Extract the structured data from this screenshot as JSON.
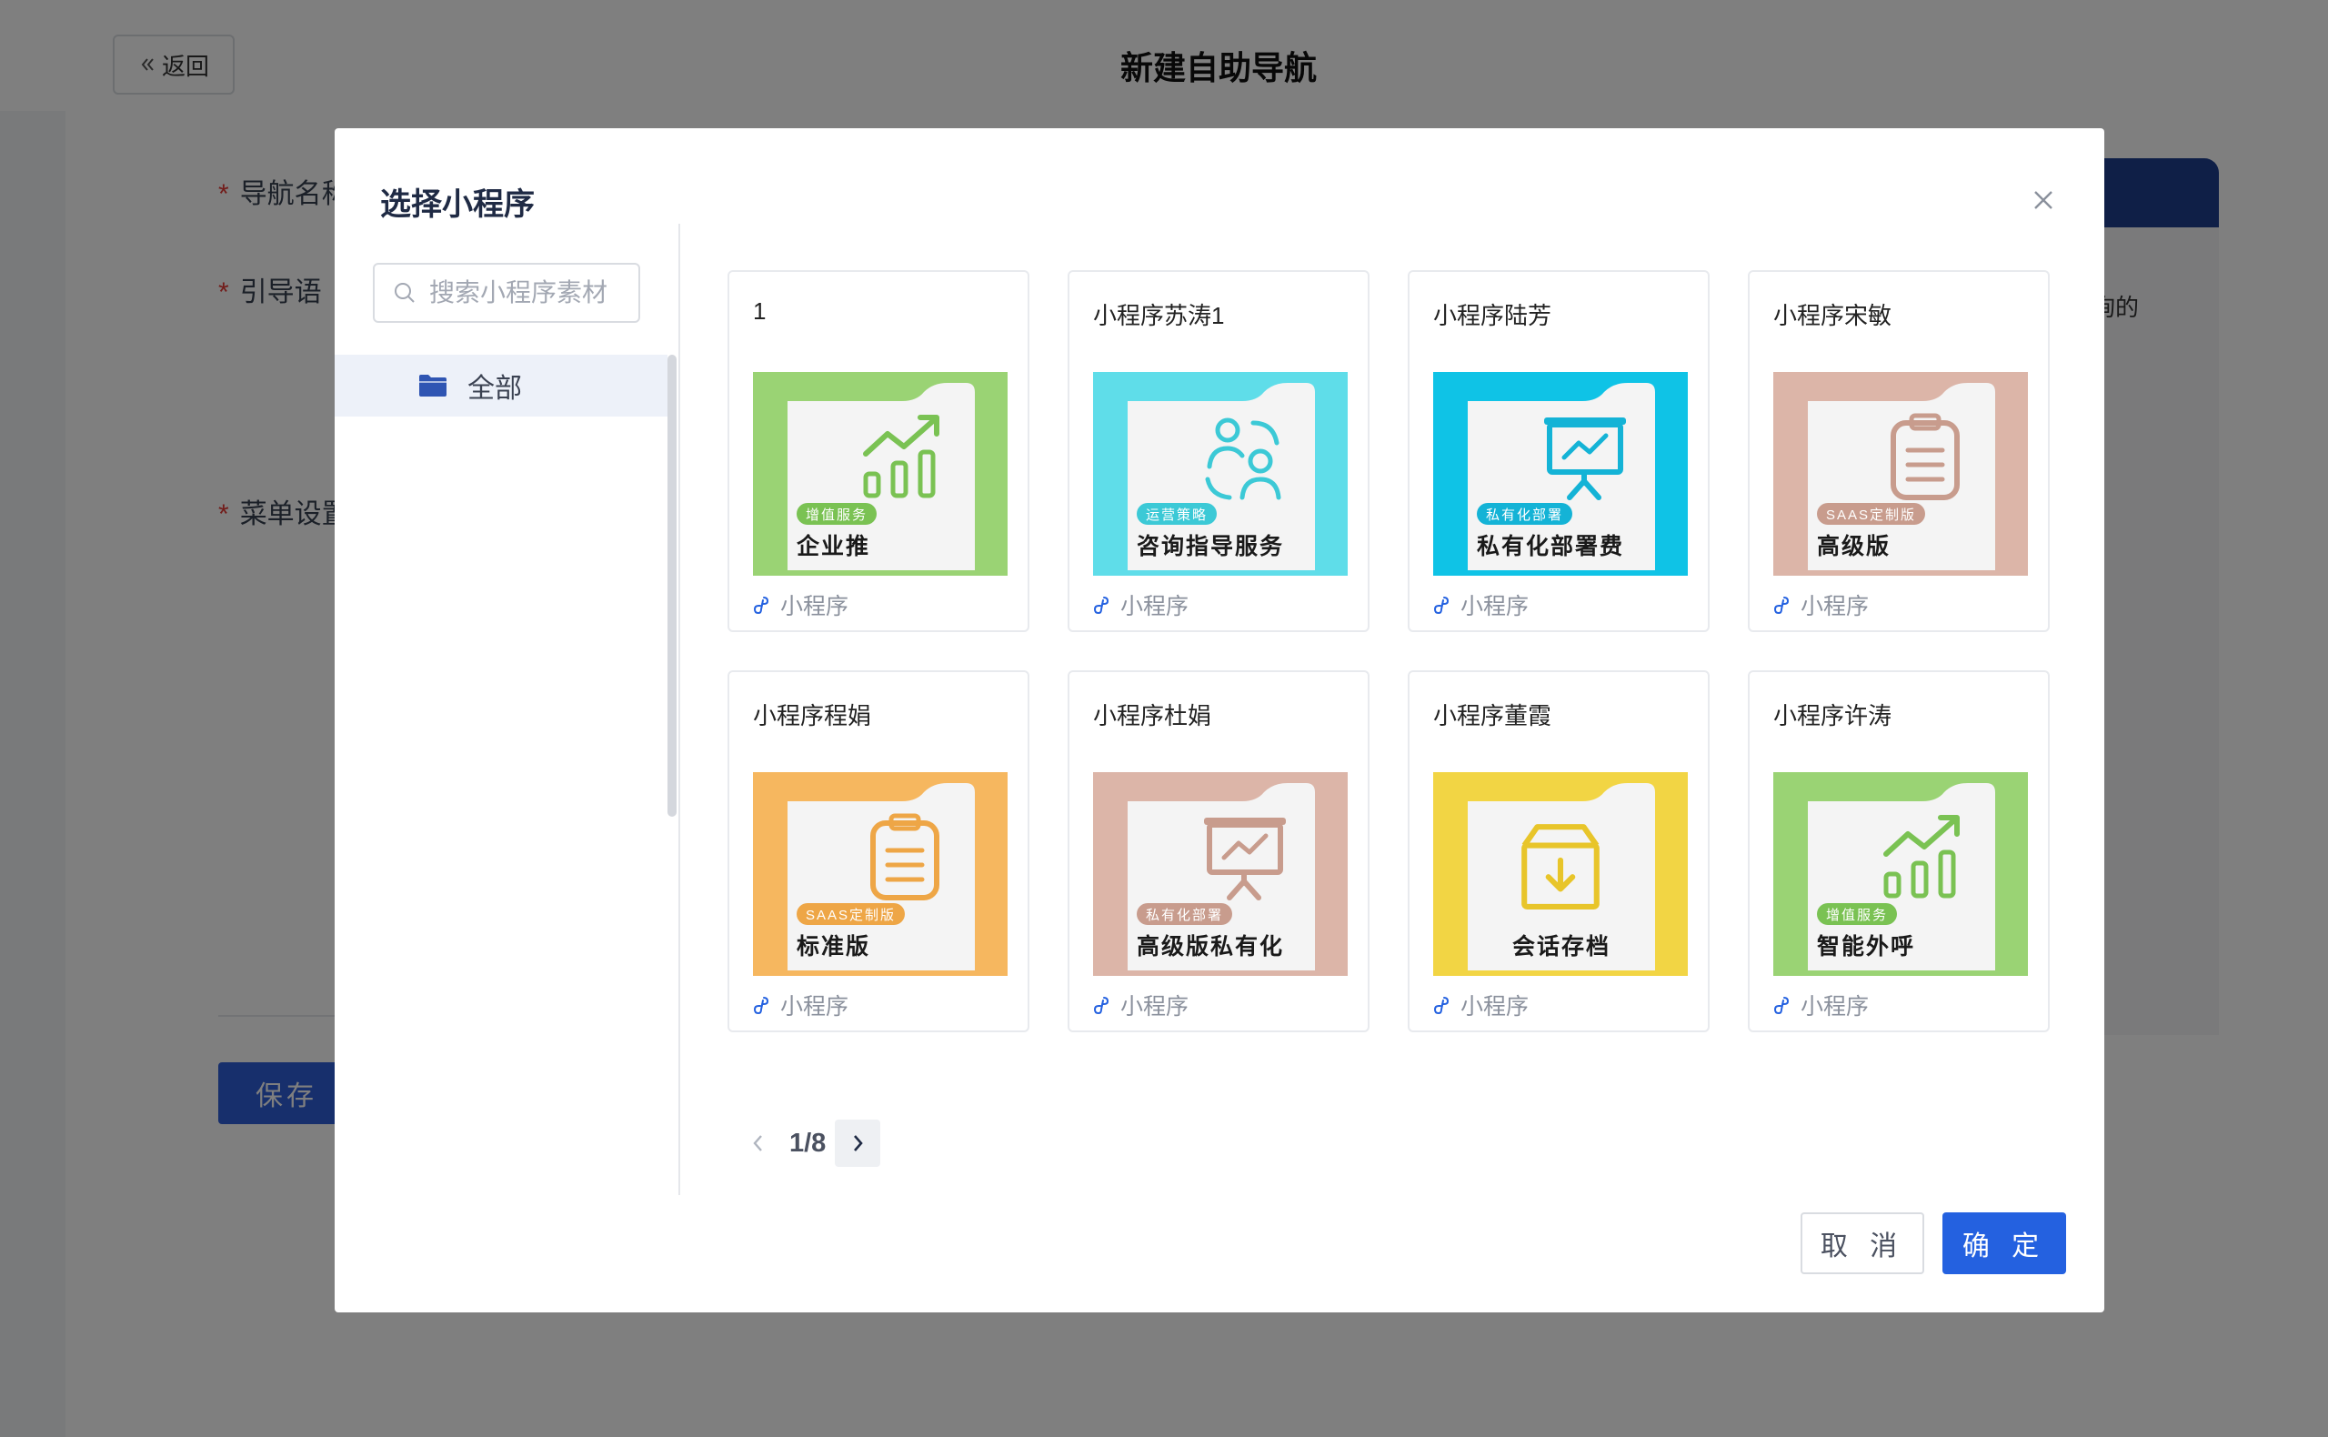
{
  "page": {
    "back_label": "返回",
    "title": "新建自助导航",
    "labels": {
      "nav_name": "导航名称",
      "guide": "引导语",
      "menu": "菜单设置"
    },
    "right_text": "询的",
    "save_label": "保存"
  },
  "modal": {
    "title": "选择小程序",
    "search_placeholder": "搜索小程序素材",
    "tree": [
      {
        "label": "全部"
      }
    ],
    "cards": [
      {
        "title": "1",
        "type": "小程序",
        "bg": "#9ad374",
        "icon": "chart-growth-icon",
        "badge": "增值服务",
        "badge_color": "#7ac253",
        "name": "企业推"
      },
      {
        "title": "小程序苏涛1",
        "type": "小程序",
        "bg": "#5fdde9",
        "icon": "people-icon",
        "badge": "运营策略",
        "badge_color": "#3cc9d6",
        "name": "咨询指导服务"
      },
      {
        "title": "小程序陆芳",
        "type": "小程序",
        "bg": "#0fc3e6",
        "icon": "presentation-icon",
        "badge": "私有化部署",
        "badge_color": "#14b3d6",
        "name": "私有化部署费"
      },
      {
        "title": "小程序宋敏",
        "type": "小程序",
        "bg": "#dcb5a8",
        "icon": "clipboard-icon",
        "badge": "SAAS定制版",
        "badge_color": "#c89c8d",
        "name": "高级版"
      },
      {
        "title": "小程序程娟",
        "type": "小程序",
        "bg": "#f6b75f",
        "icon": "clipboard-icon",
        "badge": "SAAS定制版",
        "badge_color": "#eea646",
        "name": "标准版"
      },
      {
        "title": "小程序杜娟",
        "type": "小程序",
        "bg": "#dcb5a8",
        "icon": "presentation-icon",
        "badge": "私有化部署",
        "badge_color": "#c89c8d",
        "name": "高级版私有化"
      },
      {
        "title": "小程序董霞",
        "type": "小程序",
        "bg": "#f2d544",
        "icon": "archive-box-icon",
        "badge": "",
        "badge_color": "#e8c52a",
        "name": "会话存档"
      },
      {
        "title": "小程序许涛",
        "type": "小程序",
        "bg": "#9ad374",
        "icon": "chart-growth-icon",
        "badge": "增值服务",
        "badge_color": "#7ac253",
        "name": "智能外呼"
      }
    ],
    "pager": {
      "text": "1/8"
    },
    "cancel_label": "取 消",
    "ok_label": "确 定"
  }
}
